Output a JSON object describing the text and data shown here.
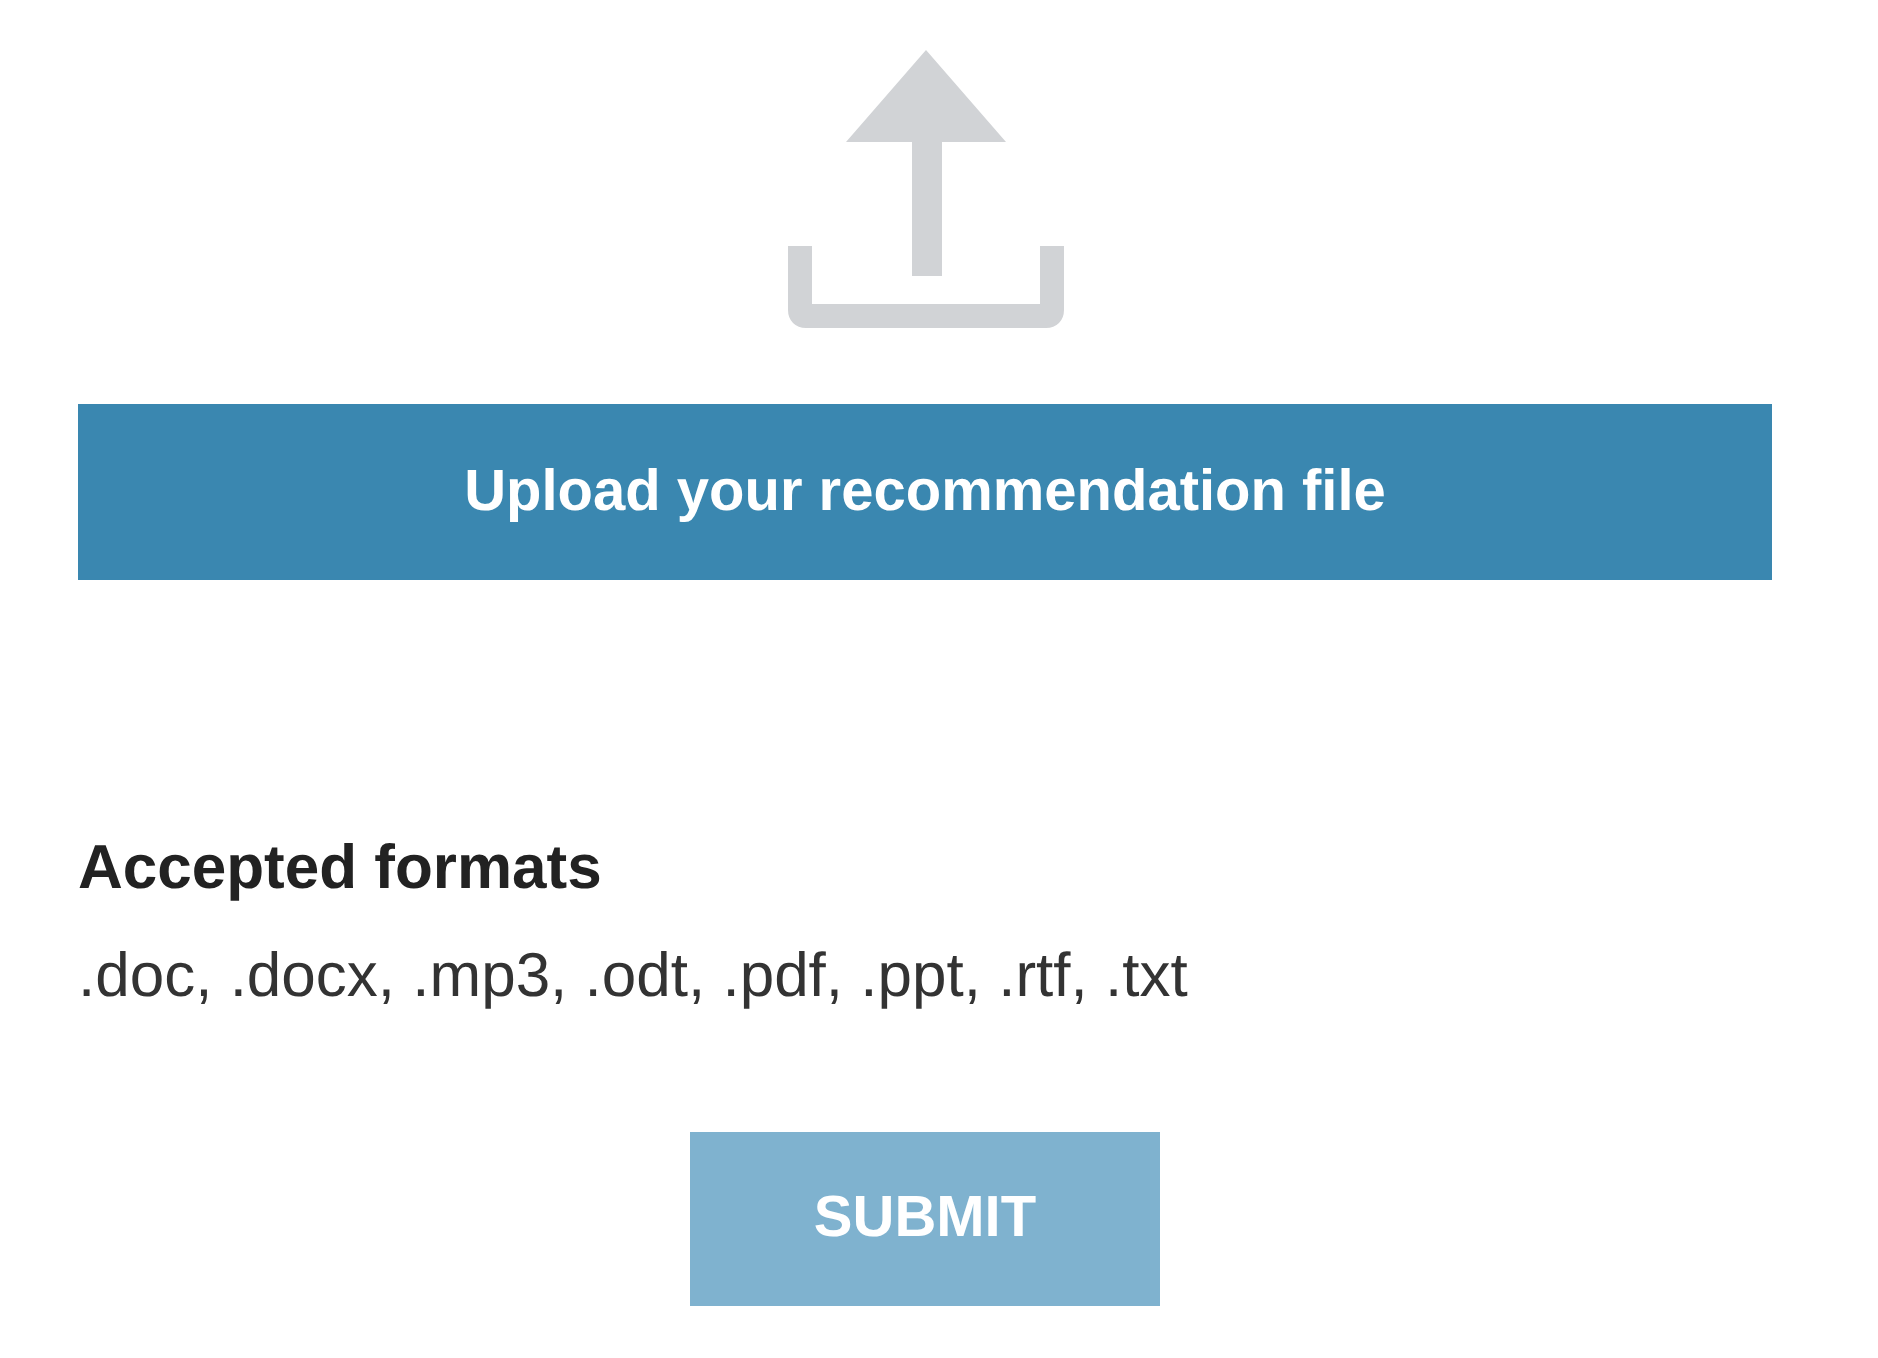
{
  "upload_button": {
    "label": "Upload your recommendation file"
  },
  "formats": {
    "heading": "Accepted formats",
    "list": ".doc, .docx, .mp3, .odt, .pdf, .ppt, .rtf, .txt"
  },
  "submit_button": {
    "label": "SUBMIT",
    "disabled": true
  }
}
